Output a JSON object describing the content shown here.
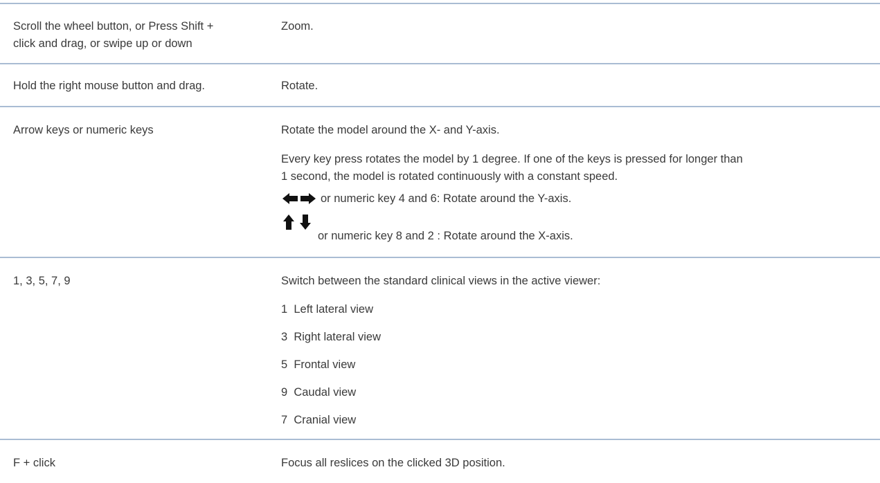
{
  "rows": [
    {
      "input_lines": [
        "Scroll the wheel button, or Press Shift +",
        "click and drag, or swipe up or down"
      ],
      "action": "Zoom."
    },
    {
      "input": "Hold the right mouse button and drag.",
      "action": "Rotate."
    },
    {
      "input": "Arrow keys or numeric keys",
      "action": "Rotate the model around the X- and Y-axis.",
      "detail_lines": [
        "Every key press rotates the model by 1 degree. If one of the keys is pressed for longer than",
        "1 second, the model is rotated continuously with a constant speed."
      ],
      "lr_text": "or numeric key 4 and 6: Rotate around the Y-axis.",
      "ud_text": "or numeric key 8 and 2 : Rotate around the X-axis.",
      "icons": [
        "arrow-left-icon",
        "arrow-right-icon",
        "arrow-up-icon",
        "arrow-down-icon"
      ]
    },
    {
      "input": "1, 3, 5, 7, 9",
      "action": "Switch between the standard clinical views in the active viewer:",
      "views": [
        "1  Left lateral view",
        "3  Right lateral view",
        "5  Frontal view",
        "9  Caudal view",
        "7  Cranial view"
      ]
    },
    {
      "input": "F + click",
      "action": "Focus all reslices on the clicked 3D position."
    }
  ]
}
